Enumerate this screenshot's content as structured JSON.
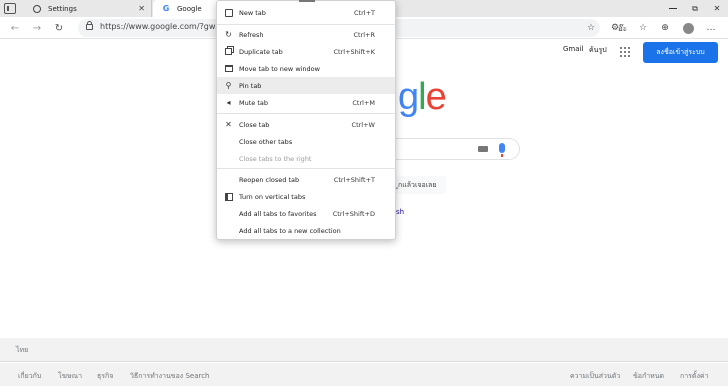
{
  "tabs": [
    {
      "title": "Settings",
      "close": "✕"
    },
    {
      "title": "Google",
      "close": "✕"
    }
  ],
  "window_controls": {
    "restore": "⧉",
    "close": "✕"
  },
  "address_bar": {
    "url": "https://www.google.com/?gws_rd=",
    "read_aloud": "อ๊ะ"
  },
  "google_header": {
    "gmail": "Gmail",
    "images": "ค้นรูป",
    "sign_in": "ลงชื่อเข้าสู่ระบบ"
  },
  "google_logo_visible": "gle",
  "lucky_button_visible": "ูกแล้วเจอเลย",
  "offer_link_visible": "sh",
  "footer": {
    "country": "ไทย",
    "left_links": [
      "เกี่ยวกับ",
      "โฆษณา",
      "ธุรกิจ",
      "วิธีการทำงานของ Search"
    ],
    "right_links": [
      "ความเป็นส่วนตัว",
      "ข้อกำหนด",
      "การตั้งค่า"
    ]
  },
  "context_menu": {
    "items": [
      {
        "label": "New tab",
        "shortcut": "Ctrl+T",
        "icon": "new-tab-icon"
      },
      {
        "label": "Refresh",
        "shortcut": "Ctrl+R",
        "icon": "refresh-icon"
      },
      {
        "label": "Duplicate tab",
        "shortcut": "Ctrl+Shift+K",
        "icon": "duplicate-icon"
      },
      {
        "label": "Move tab to new window",
        "shortcut": "",
        "icon": "window-icon"
      },
      {
        "label": "Pin tab",
        "shortcut": "",
        "icon": "pin-icon"
      },
      {
        "label": "Mute tab",
        "shortcut": "Ctrl+M",
        "icon": "speaker-icon"
      },
      {
        "label": "Close tab",
        "shortcut": "Ctrl+W",
        "icon": "close-icon"
      },
      {
        "label": "Close other tabs",
        "shortcut": "",
        "icon": ""
      },
      {
        "label": "Close tabs to the right",
        "shortcut": "",
        "icon": ""
      },
      {
        "label": "Reopen closed tab",
        "shortcut": "Ctrl+Shift+T",
        "icon": ""
      },
      {
        "label": "Turn on vertical tabs",
        "shortcut": "",
        "icon": "vertical-tabs-icon"
      },
      {
        "label": "Add all tabs to favorites",
        "shortcut": "Ctrl+Shift+D",
        "icon": ""
      },
      {
        "label": "Add all tabs to a new collection",
        "shortcut": "",
        "icon": ""
      }
    ],
    "hovered": "Pin tab",
    "disabled": [
      "Close tabs to the right"
    ]
  },
  "colors": {
    "accent": "#1a73e8",
    "menu_hover": "#ececec"
  }
}
